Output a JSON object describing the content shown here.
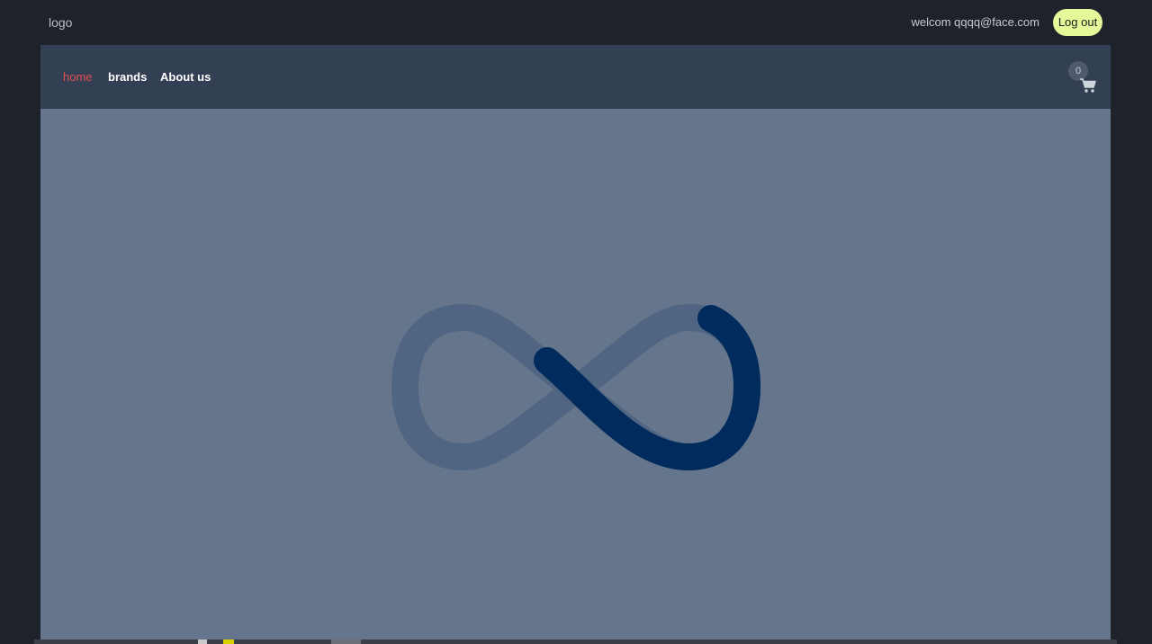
{
  "header": {
    "logo": "logo",
    "welcome": "welcom qqqq@face.com",
    "logout_label": "Log out"
  },
  "nav": {
    "items": [
      {
        "label": "home",
        "active": true
      },
      {
        "label": "brands",
        "active": false
      },
      {
        "label": "About us",
        "active": false
      }
    ],
    "cart_count": "0",
    "cart_icon": "shopping-cart-icon"
  },
  "loader": {
    "icon": "infinity-loader-icon"
  },
  "colors": {
    "background": "#1e232b",
    "navbar": "#333f52",
    "main": "#65758c",
    "accent_active": "#e0514f",
    "logout_button": "#e6f99a",
    "loader_track": "#4f6582",
    "loader_stroke": "#002b5c"
  }
}
